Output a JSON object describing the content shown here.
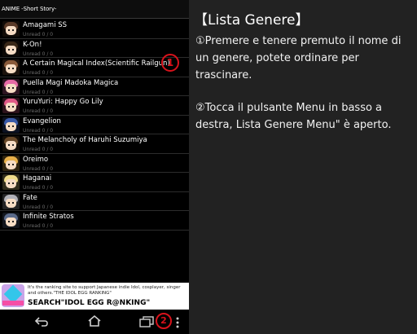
{
  "app_title": "ANIME -Short Story-",
  "genres": [
    {
      "title": "Amagami SS",
      "unread": "Unread 0 / 0",
      "hair": "#5a3a28"
    },
    {
      "title": "K-On!",
      "unread": "Unread 0 / 0",
      "hair": "#3a2818"
    },
    {
      "title": "A Certain Magical Index(Scientific Railgun)",
      "unread": "Unread 0 / 0",
      "hair": "#8a5a3a"
    },
    {
      "title": "Puella Magi Madoka Magica",
      "unread": "Unread 0 / 0",
      "hair": "#e86aa6"
    },
    {
      "title": "YuruYuri: Happy Go Lily",
      "unread": "Unread 0 / 0",
      "hair": "#e25a88"
    },
    {
      "title": "Evangelion",
      "unread": "Unread 0 / 0",
      "hair": "#3a5aa8"
    },
    {
      "title": "The Melancholy of Haruhi Suzumiya",
      "unread": "Unread 0 / 0",
      "hair": "#6a4a2a"
    },
    {
      "title": "Oreimo",
      "unread": "Unread 0 / 0",
      "hair": "#e8b04a"
    },
    {
      "title": "Haganai",
      "unread": "Unread 0 / 0",
      "hair": "#f0dc8a"
    },
    {
      "title": "Fate",
      "unread": "Unread 0 / 0",
      "hair": "#b0b0b8"
    },
    {
      "title": "Infinite Stratos",
      "unread": "Unread 0 / 0",
      "hair": "#5a6a8a"
    }
  ],
  "markers": {
    "one": "1",
    "two": "2"
  },
  "ad": {
    "line1": "It's the ranking site to support Japanese indie Idol, cosplayer, singer and others.\"THE IDOL EGG RANKING\"",
    "line2": "SEARCH\"IDOL EGG R@NKING\""
  },
  "nav": {
    "back_icon": "back-arrow-icon",
    "home_icon": "home-icon",
    "recents_icon": "recents-icon",
    "menu_icon": "menu-dots-icon"
  },
  "help": {
    "title": "【Lista Genere】",
    "p1": "①Premere e tenere premuto il nome di un genere, potete ordinare per trascinare.",
    "p2": "②Tocca il pulsante Menu in basso a destra, Lista Genere Menu\" è aperto."
  },
  "colors": {
    "marker": "#d8121b",
    "background": "#222222",
    "list_bg": "#000000"
  }
}
